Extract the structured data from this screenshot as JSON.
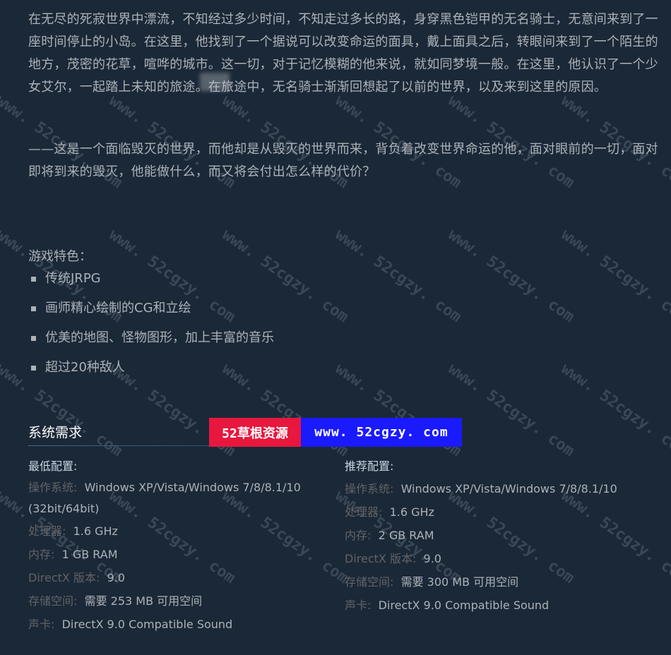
{
  "description": {
    "paragraph1": "在无尽的死寂世界中漂流，不知经过多少时间，不知走过多长的路，身穿黑色铠甲的无名骑士，无意间来到了一座时间停止的小岛。在这里，他找到了一个据说可以改变命运的面具，戴上面具之后，转眼间来到了一个陌生的地方，茂密的花草，喧哗的城市。这一切，对于记忆模糊的他来说，就如同梦境一般。在这里，他认识了一个少女艾尔，一起踏上未知的旅途。在旅途中，无名骑士渐渐回想起了以前的世界，以及来到这里的原因。",
    "paragraph2": "——这是一个面临毁灭的世界，而他却是从毁灭的世界而来，背负着改变世界命运的他，面对眼前的一切，面对即将到来的毁灭，他能做什么，而又将会付出怎么样的代价？"
  },
  "features": {
    "title": "游戏特色：",
    "items": [
      "传统JRPG",
      "画师精心绘制的CG和立绘",
      "优美的地图、怪物图形，加上丰富的音乐",
      "超过20种敌人"
    ]
  },
  "system_requirements": {
    "title": "系统需求",
    "minimum": {
      "heading": "最低配置:",
      "os_label": "操作系统:",
      "os_value": "Windows XP/Vista/Windows 7/8/8.1/10 (32bit/64bit)",
      "cpu_label": "处理器:",
      "cpu_value": "1.6 GHz",
      "ram_label": "内存:",
      "ram_value": "1 GB RAM",
      "dx_label": "DirectX 版本:",
      "dx_value": "9.0",
      "storage_label": "存储空间:",
      "storage_value": "需要 253 MB 可用空间",
      "sound_label": "声卡:",
      "sound_value": "DirectX 9.0 Compatible Sound"
    },
    "recommended": {
      "heading": "推荐配置:",
      "os_label": "操作系统:",
      "os_value": "Windows XP/Vista/Windows 7/8/8.1/10",
      "cpu_label": "处理器:",
      "cpu_value": "1.6 GHz",
      "ram_label": "内存:",
      "ram_value": "2 GB RAM",
      "dx_label": "DirectX 版本:",
      "dx_value": "9.0",
      "storage_label": "存储空间:",
      "storage_value": "需要 300 MB 可用空间",
      "sound_label": "声卡:",
      "sound_value": "DirectX 9.0 Compatible Sound"
    }
  },
  "watermark": {
    "banner_cn": "52草根资源",
    "banner_url": "www. 52cgzy. com",
    "diagonal_text": "www. 52cgzy. com"
  },
  "colors": {
    "background": "#1b2838",
    "text": "#acb2b8",
    "label": "#626366",
    "heading_white": "#ffffff",
    "banner_red": "#e8173e",
    "banner_blue": "#1a1aff"
  }
}
